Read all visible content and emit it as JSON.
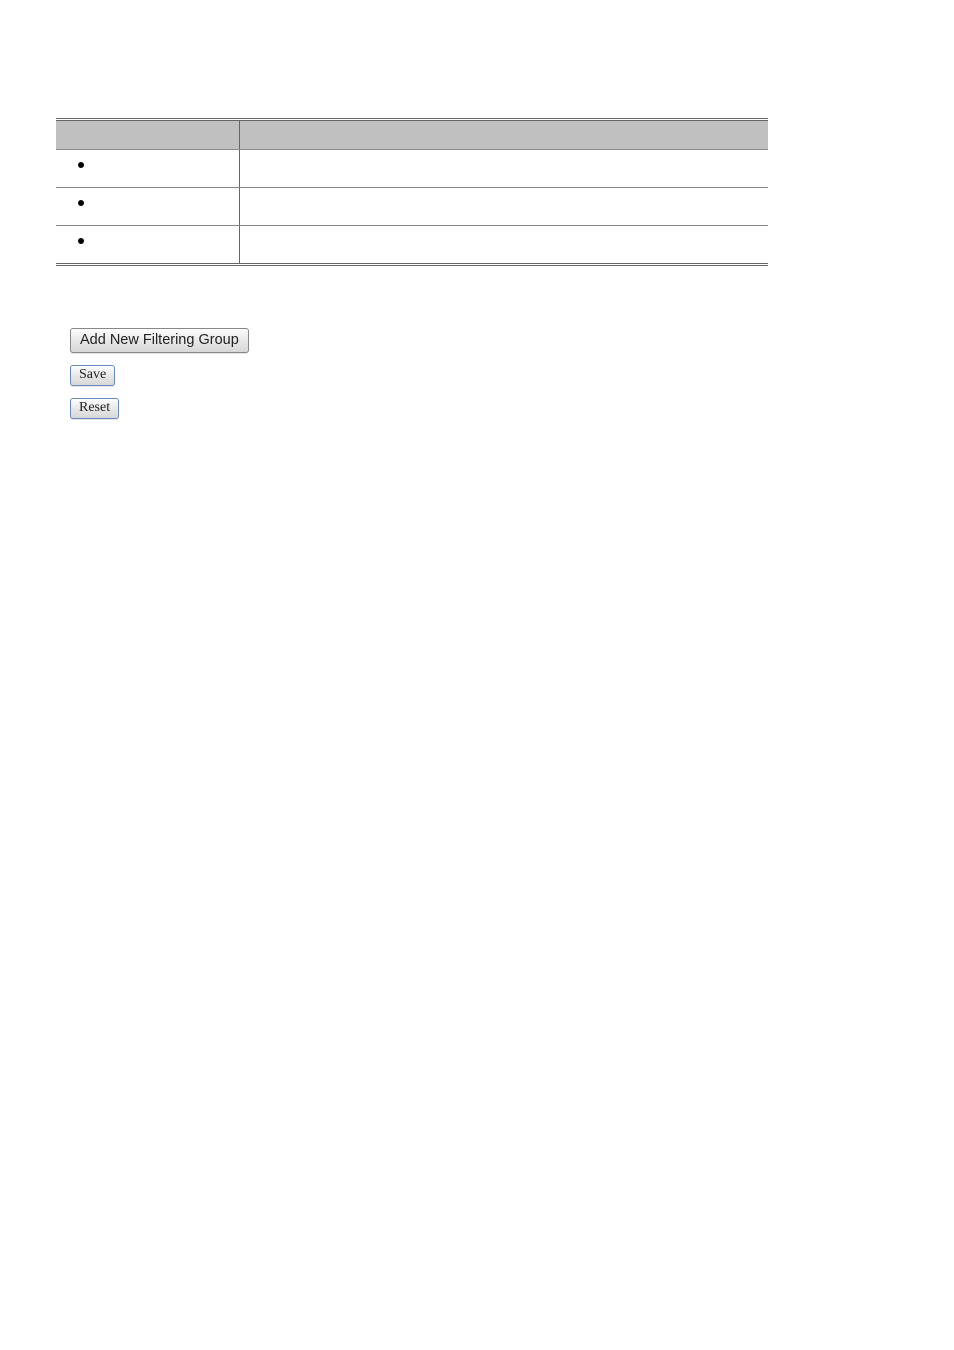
{
  "table": {
    "header": {
      "col1": "",
      "col2": ""
    },
    "rows": [
      {
        "bullet": true,
        "col2": ""
      },
      {
        "bullet": true,
        "col2": ""
      },
      {
        "bullet": true,
        "col2": ""
      }
    ]
  },
  "buttons": {
    "add_new_filtering_group": "Add New Filtering Group",
    "save": "Save",
    "reset": "Reset"
  }
}
